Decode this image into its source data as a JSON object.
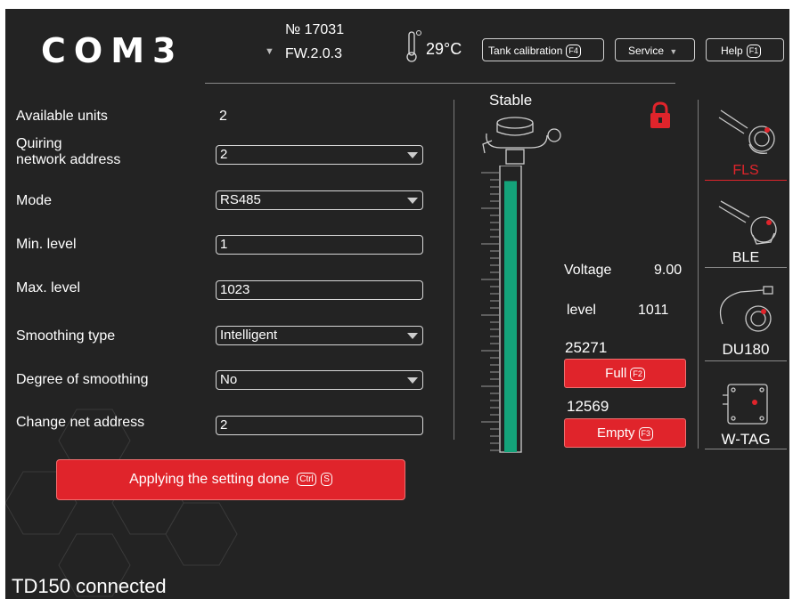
{
  "header": {
    "logo": "COM3",
    "device_number": "№ 17031",
    "firmware": "FW.2.0.3",
    "temperature": "29°C",
    "buttons": [
      {
        "label": "Tank calibration",
        "key": "F4"
      },
      {
        "label": "Service",
        "key": ""
      },
      {
        "label": "Help",
        "key": "F1"
      }
    ]
  },
  "form": {
    "available_units": {
      "label": "Available units",
      "value": "2"
    },
    "quiring_address": {
      "label_line1": "Quiring",
      "label_line2": "network address",
      "value": "2"
    },
    "mode": {
      "label": "Mode",
      "value": "RS485"
    },
    "min_level": {
      "label": "Min. level",
      "value": "1"
    },
    "max_level": {
      "label": "Max. level",
      "value": "1023"
    },
    "smoothing_type": {
      "label": "Smoothing type",
      "value": "Intelligent"
    },
    "degree_of_smoothing": {
      "label": "Degree of smoothing",
      "value": "No"
    },
    "change_net_address": {
      "label": "Change net address",
      "value": "2"
    }
  },
  "apply_button": {
    "label": "Applying the setting done",
    "keys": [
      "Ctrl",
      "S"
    ]
  },
  "sensor": {
    "state": "Stable",
    "level_fill_fraction": 0.97,
    "lock_color": "#e0242b",
    "voltage_label": "Voltage",
    "voltage_value": "9.00",
    "level_label": "level",
    "level_value": "1011",
    "full_value": "25271",
    "full_button": {
      "label": "Full",
      "key": "F2"
    },
    "empty_value": "12569",
    "empty_button": {
      "label": "Empty",
      "key": "F3"
    }
  },
  "sidebar": {
    "items": [
      {
        "label": "FLS",
        "active": true
      },
      {
        "label": "BLE",
        "active": false
      },
      {
        "label": "DU180",
        "active": false
      },
      {
        "label": "W-TAG",
        "active": false
      }
    ]
  },
  "status_text": "TD150 connected",
  "colors": {
    "accent": "#e0242b",
    "gauge": "#14a37a",
    "background": "#232323"
  }
}
